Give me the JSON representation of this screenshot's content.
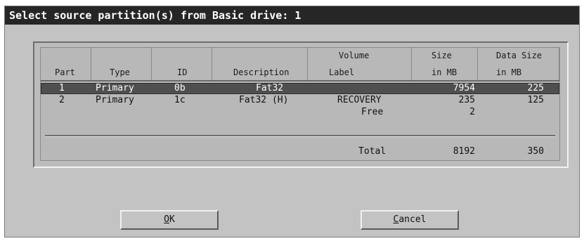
{
  "dialog": {
    "title": "Select source partition(s) from Basic drive: 1"
  },
  "table": {
    "headers": [
      {
        "line1": "",
        "line2": "Part"
      },
      {
        "line1": "",
        "line2": "Type"
      },
      {
        "line1": "",
        "line2": "ID"
      },
      {
        "line1": "",
        "line2": "Description"
      },
      {
        "line1": "Volume",
        "line2": "Label"
      },
      {
        "line1": "Size",
        "line2": "in MB"
      },
      {
        "line1": "Data Size",
        "line2": "in MB"
      }
    ],
    "rows": [
      {
        "part": "1",
        "type": "Primary",
        "id": "0b",
        "description": "Fat32",
        "label": "",
        "size": "7954",
        "data_size": "225",
        "selected": true
      },
      {
        "part": "2",
        "type": "Primary",
        "id": "1c",
        "description": "Fat32 (H)",
        "label": "RECOVERY",
        "size": "235",
        "data_size": "125",
        "selected": false
      },
      {
        "part": "",
        "type": "",
        "id": "",
        "description": "",
        "label": "Free",
        "size": "2",
        "data_size": "",
        "selected": false
      }
    ],
    "total": {
      "label": "Total",
      "size": "8192",
      "data_size": "350"
    }
  },
  "buttons": {
    "ok": {
      "mnemonic": "O",
      "rest": "K"
    },
    "cancel": {
      "mnemonic": "C",
      "rest": "ancel"
    }
  },
  "colors": {
    "title_bar": "#262626",
    "dialog_bg": "#c3c3c3",
    "selected_row": "#4f4f4f"
  }
}
